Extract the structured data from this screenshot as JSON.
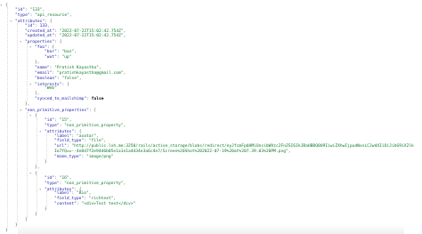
{
  "json_viewer": {
    "lines": [
      {
        "indent": 0,
        "toggle": "▾",
        "tokens": [
          {
            "t": "p",
            "v": "{"
          }
        ]
      },
      {
        "indent": 1,
        "tokens": [
          {
            "t": "k",
            "v": "\"id\""
          },
          {
            "t": "p",
            "v": ": "
          },
          {
            "t": "s",
            "v": "\"133\""
          },
          {
            "t": "p",
            "v": ","
          }
        ]
      },
      {
        "indent": 1,
        "tokens": [
          {
            "t": "k",
            "v": "\"type\""
          },
          {
            "t": "p",
            "v": ": "
          },
          {
            "t": "s",
            "v": "\"api_resource\""
          },
          {
            "t": "p",
            "v": ","
          }
        ]
      },
      {
        "indent": 1,
        "toggle": "▾",
        "tokens": [
          {
            "t": "k",
            "v": "\"attributes\""
          },
          {
            "t": "p",
            "v": ": {"
          }
        ]
      },
      {
        "indent": 2,
        "tokens": [
          {
            "t": "k",
            "v": "\"id\""
          },
          {
            "t": "p",
            "v": ": "
          },
          {
            "t": "n",
            "v": "133"
          },
          {
            "t": "p",
            "v": ","
          }
        ]
      },
      {
        "indent": 2,
        "tokens": [
          {
            "t": "k",
            "v": "\"created_at\""
          },
          {
            "t": "p",
            "v": ": "
          },
          {
            "t": "s",
            "v": "\"2022-07-22T15:02:42.754Z\""
          },
          {
            "t": "p",
            "v": ","
          }
        ]
      },
      {
        "indent": 2,
        "tokens": [
          {
            "t": "k",
            "v": "\"updated_at\""
          },
          {
            "t": "p",
            "v": ": "
          },
          {
            "t": "s",
            "v": "\"2022-07-22T15:02:42.754Z\""
          },
          {
            "t": "p",
            "v": ","
          }
        ]
      },
      {
        "indent": 2,
        "toggle": "▾",
        "tokens": [
          {
            "t": "k",
            "v": "\"properties\""
          },
          {
            "t": "p",
            "v": ": {"
          }
        ]
      },
      {
        "indent": 3,
        "toggle": "▾",
        "tokens": [
          {
            "t": "k",
            "v": "\"foo\""
          },
          {
            "t": "p",
            "v": ": {"
          }
        ]
      },
      {
        "indent": 4,
        "tokens": [
          {
            "t": "k",
            "v": "\"bar\""
          },
          {
            "t": "p",
            "v": ": "
          },
          {
            "t": "s",
            "v": "\"baz\""
          },
          {
            "t": "p",
            "v": ","
          }
        ]
      },
      {
        "indent": 4,
        "tokens": [
          {
            "t": "k",
            "v": "\"wut\""
          },
          {
            "t": "p",
            "v": ": "
          },
          {
            "t": "s",
            "v": "\"up\""
          }
        ]
      },
      {
        "indent": 3,
        "tokens": [
          {
            "t": "p",
            "v": "},"
          }
        ]
      },
      {
        "indent": 3,
        "tokens": [
          {
            "t": "k",
            "v": "\"name\""
          },
          {
            "t": "p",
            "v": ": "
          },
          {
            "t": "s",
            "v": "\"Pratish Kayastha\""
          },
          {
            "t": "p",
            "v": ","
          }
        ]
      },
      {
        "indent": 3,
        "tokens": [
          {
            "t": "k",
            "v": "\"email\""
          },
          {
            "t": "p",
            "v": ": "
          },
          {
            "t": "s",
            "v": "\"pratishkayastha@gmail.com\""
          },
          {
            "t": "p",
            "v": ","
          }
        ]
      },
      {
        "indent": 3,
        "tokens": [
          {
            "t": "k",
            "v": "\"boolean\""
          },
          {
            "t": "p",
            "v": ": "
          },
          {
            "t": "s",
            "v": "\"false\""
          },
          {
            "t": "p",
            "v": ","
          }
        ]
      },
      {
        "indent": 3,
        "toggle": "▾",
        "tokens": [
          {
            "t": "k",
            "v": "\"interests\""
          },
          {
            "t": "p",
            "v": ": ["
          }
        ]
      },
      {
        "indent": 4,
        "tokens": [
          {
            "t": "s",
            "v": "\"Web\""
          }
        ]
      },
      {
        "indent": 3,
        "tokens": [
          {
            "t": "p",
            "v": "],"
          }
        ]
      },
      {
        "indent": 3,
        "tokens": [
          {
            "t": "k",
            "v": "\"synced_to_mailchimp\""
          },
          {
            "t": "p",
            "v": ": "
          },
          {
            "t": "b",
            "v": "false"
          }
        ]
      },
      {
        "indent": 2,
        "tokens": [
          {
            "t": "p",
            "v": "},"
          }
        ]
      },
      {
        "indent": 2,
        "toggle": "▾",
        "tokens": [
          {
            "t": "k",
            "v": "\"non_primitive_properties\""
          },
          {
            "t": "p",
            "v": ": ["
          }
        ]
      },
      {
        "indent": 3,
        "toggle": "▾",
        "tokens": [
          {
            "t": "p",
            "v": "{"
          }
        ]
      },
      {
        "indent": 4,
        "tokens": [
          {
            "t": "k",
            "v": "\"id\""
          },
          {
            "t": "p",
            "v": ": "
          },
          {
            "t": "s",
            "v": "\"15\""
          },
          {
            "t": "p",
            "v": ","
          }
        ]
      },
      {
        "indent": 4,
        "tokens": [
          {
            "t": "k",
            "v": "\"type\""
          },
          {
            "t": "p",
            "v": ": "
          },
          {
            "t": "s",
            "v": "\"non_primitive_property\""
          },
          {
            "t": "p",
            "v": ","
          }
        ]
      },
      {
        "indent": 4,
        "toggle": "▾",
        "tokens": [
          {
            "t": "k",
            "v": "\"attributes\""
          },
          {
            "t": "p",
            "v": ": {"
          }
        ]
      },
      {
        "indent": 5,
        "tokens": [
          {
            "t": "k",
            "v": "\"label\""
          },
          {
            "t": "p",
            "v": ": "
          },
          {
            "t": "s",
            "v": "\"avatar\""
          },
          {
            "t": "p",
            "v": ","
          }
        ]
      },
      {
        "indent": 5,
        "tokens": [
          {
            "t": "k",
            "v": "\"field_type\""
          },
          {
            "t": "p",
            "v": ": "
          },
          {
            "t": "s",
            "v": "\"file\""
          },
          {
            "t": "p",
            "v": ","
          }
        ]
      },
      {
        "indent": 5,
        "tokens": [
          {
            "t": "k",
            "v": "\"url\""
          },
          {
            "t": "p",
            "v": ": "
          },
          {
            "t": "s",
            "v": "\"http://public.lvh.me:3250/rails/active_storage/blobs/redirect/eyJfcmFpbHMiOnsibWVzc2FnZSI6IkJBaHBBQ0U9IiwiZXhwIjpudWxsLCJwdXIiOiJibG9iX2lk"
          }
        ]
      },
      {
        "indent": 5,
        "tokens": [
          {
            "t": "s",
            "v": "Io7fQ==--4e8d7f2e94d6b05e1a1e1a4d34e3a6c4e7/Screen%20Shot%202022-07-19%20at%207.39.03%20PM.png\""
          },
          {
            "t": "p",
            "v": ","
          }
        ]
      },
      {
        "indent": 5,
        "tokens": [
          {
            "t": "k",
            "v": "\"mime_type\""
          },
          {
            "t": "p",
            "v": ": "
          },
          {
            "t": "s",
            "v": "\"image/png\""
          }
        ]
      },
      {
        "indent": 4,
        "tokens": [
          {
            "t": "p",
            "v": "}"
          }
        ]
      },
      {
        "indent": 3,
        "tokens": [
          {
            "t": "p",
            "v": "},"
          }
        ]
      },
      {
        "indent": 3,
        "toggle": "▾",
        "tokens": [
          {
            "t": "p",
            "v": "{"
          }
        ]
      },
      {
        "indent": 4,
        "tokens": [
          {
            "t": "k",
            "v": "\"id\""
          },
          {
            "t": "p",
            "v": ": "
          },
          {
            "t": "s",
            "v": "\"16\""
          },
          {
            "t": "p",
            "v": ","
          }
        ]
      },
      {
        "indent": 4,
        "tokens": [
          {
            "t": "k",
            "v": "\"type\""
          },
          {
            "t": "p",
            "v": ": "
          },
          {
            "t": "s",
            "v": "\"non_primitive_property\""
          },
          {
            "t": "p",
            "v": ","
          }
        ]
      },
      {
        "indent": 4,
        "toggle": "▾",
        "tokens": [
          {
            "t": "k",
            "v": "\"attributes\""
          },
          {
            "t": "p",
            "v": ": {"
          }
        ]
      },
      {
        "indent": 5,
        "tokens": [
          {
            "t": "k",
            "v": "\"label\""
          },
          {
            "t": "p",
            "v": ": "
          },
          {
            "t": "s",
            "v": "\"Bio\""
          },
          {
            "t": "p",
            "v": ","
          }
        ]
      },
      {
        "indent": 5,
        "tokens": [
          {
            "t": "k",
            "v": "\"field_type\""
          },
          {
            "t": "p",
            "v": ": "
          },
          {
            "t": "s",
            "v": "\"richtext\""
          },
          {
            "t": "p",
            "v": ","
          }
        ]
      },
      {
        "indent": 5,
        "tokens": [
          {
            "t": "k",
            "v": "\"content\""
          },
          {
            "t": "p",
            "v": ": "
          },
          {
            "t": "s",
            "v": "\"<div>Test text</div>\""
          }
        ]
      },
      {
        "indent": 4,
        "tokens": [
          {
            "t": "p",
            "v": "}"
          }
        ]
      },
      {
        "indent": 3,
        "tokens": [
          {
            "t": "p",
            "v": "}"
          }
        ]
      },
      {
        "indent": 2,
        "tokens": [
          {
            "t": "p",
            "v": "]"
          }
        ]
      },
      {
        "indent": 1,
        "tokens": [
          {
            "t": "p",
            "v": "}"
          }
        ]
      },
      {
        "indent": 0,
        "tokens": [
          {
            "t": "p",
            "v": "}"
          }
        ]
      }
    ]
  }
}
